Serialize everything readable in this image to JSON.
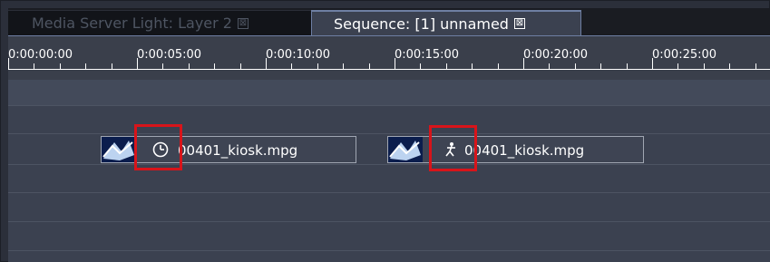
{
  "tabs": [
    {
      "label": "Media Server Light: Layer 2",
      "active": false
    },
    {
      "label": "Sequence: [1] unnamed",
      "active": true
    }
  ],
  "tab_close_glyph": "⊠",
  "ruler": {
    "timecodes": [
      "0:00:00:00",
      "0:00:05:00",
      "0:00:10:00",
      "0:00:15:00",
      "0:00:20:00",
      "0:00:25:00"
    ]
  },
  "clips": [
    {
      "label": "00401_kiosk.mpg",
      "status_icon": "clock-icon"
    },
    {
      "label": "00401_kiosk.mpg",
      "status_icon": "running-figure-icon"
    }
  ],
  "colors": {
    "highlight": "#d8141a",
    "background": "#3b4150",
    "active_tab": "#3b4150",
    "inactive_tab": "#121419"
  }
}
